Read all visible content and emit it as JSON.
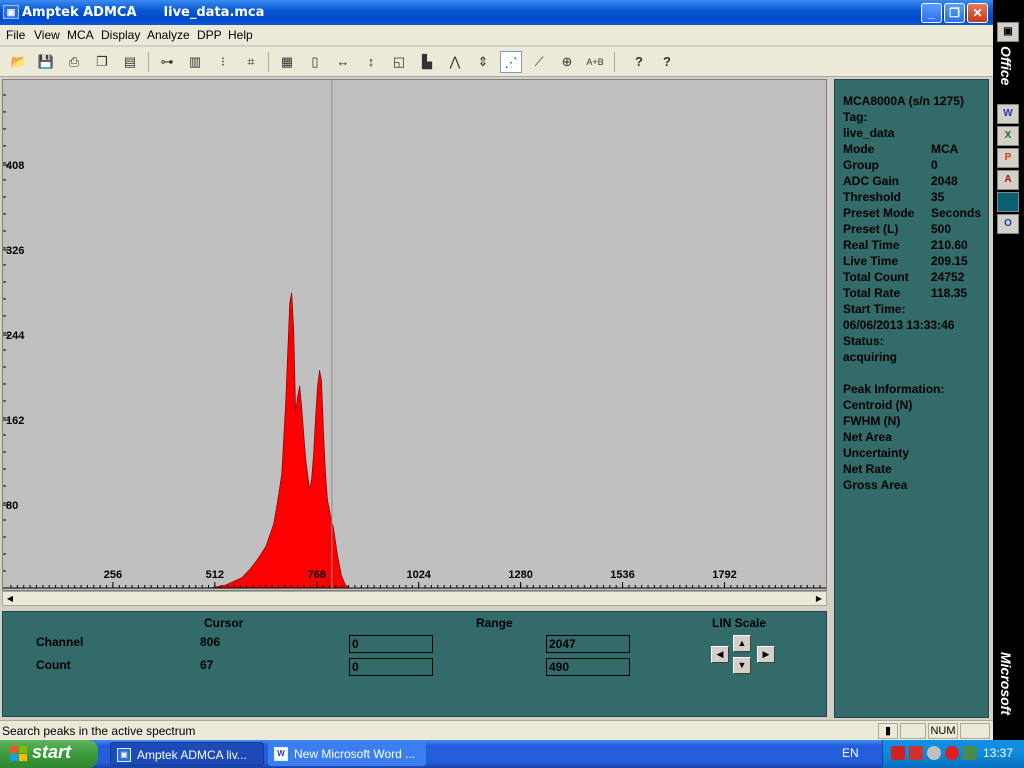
{
  "window": {
    "app_name": "Amptek ADMCA",
    "file_name": "live_data.mca",
    "minimize": "_",
    "maximize": "❐",
    "close": "✕"
  },
  "menu": [
    "File",
    "View",
    "MCA",
    "Display",
    "Analyze",
    "DPP",
    "Help"
  ],
  "toolbar_icons": [
    "open-icon",
    "save-icon",
    "print-icon",
    "copy-icon",
    "properties-icon",
    "connect-icon",
    "acquire-icon",
    "traffic-light-icon",
    "clear-icon",
    "color-icon",
    "list-icon",
    "horizontal-zoom-icon",
    "vertical-zoom-icon",
    "fit-icon",
    "bars-icon",
    "peaks-icon",
    "autoscale-icon",
    "points-icon",
    "line-icon",
    "zoom-icon",
    "a-plus-b-icon",
    "help-icon",
    "context-help-icon"
  ],
  "toolbar_glyphs": {
    "a_plus_b": "A+B",
    "help": "?",
    "context_help": "?"
  },
  "chart_data": {
    "type": "area",
    "title": "",
    "xlabel": "",
    "ylabel": "",
    "xlim": [
      0,
      2047
    ],
    "ylim": [
      0,
      490
    ],
    "x_ticks": [
      256,
      512,
      768,
      1024,
      1280,
      1536,
      1792
    ],
    "y_ticks": [
      80,
      162,
      244,
      326,
      408
    ],
    "grid": false,
    "cursor_channel": 806,
    "fill_color": "#ff0000",
    "background": "#c0c0c0",
    "series": [
      {
        "x": [
          0,
          500,
          540,
          580,
          600,
          620,
          640,
          660,
          670,
          680,
          690,
          700,
          705,
          710,
          715,
          720,
          725,
          730,
          740,
          750,
          755,
          760,
          765,
          770,
          775,
          780,
          785,
          790,
          795,
          800,
          805,
          810,
          820,
          830,
          840,
          850,
          2047
        ],
        "y": [
          0,
          0,
          3,
          10,
          18,
          28,
          40,
          62,
          85,
          110,
          180,
          275,
          285,
          250,
          170,
          185,
          195,
          175,
          125,
          95,
          105,
          130,
          165,
          195,
          210,
          200,
          150,
          110,
          85,
          75,
          65,
          58,
          32,
          12,
          3,
          0,
          0
        ]
      }
    ]
  },
  "cursor_panel": {
    "cursor_header": "Cursor",
    "range_header": "Range",
    "scale_header": "LIN Scale",
    "channel_label": "Channel",
    "channel_value": "806",
    "count_label": "Count",
    "count_value": "67",
    "channel_range_min": "0",
    "channel_range_max": "2047",
    "count_range_min": "0",
    "count_range_max": "490"
  },
  "info": {
    "device": "MCA8000A (s/n     1275)",
    "tag_label": "Tag:",
    "tag_value": "live_data",
    "rows": [
      {
        "label": "Mode",
        "value": "MCA"
      },
      {
        "label": "Group",
        "value": "0"
      },
      {
        "label": "ADC Gain",
        "value": "2048"
      },
      {
        "label": "Threshold",
        "value": "35"
      },
      {
        "label": "Preset Mode",
        "value": "Seconds"
      },
      {
        "label": "Preset (L)",
        "value": "500"
      },
      {
        "label": "Real Time",
        "value": "210.60"
      },
      {
        "label": "Live Time",
        "value": "209.15"
      },
      {
        "label": "Total Count",
        "value": "24752"
      },
      {
        "label": "Total Rate",
        "value": "118.35"
      }
    ],
    "start_label": "Start Time:",
    "start_value": "06/06/2013 13:33:46",
    "status_label": "Status:",
    "status_value": "acquiring",
    "peak_header": "Peak Information:",
    "peak_rows": [
      "Centroid (N)",
      "FWHM (N)",
      "Net Area",
      "Uncertainty",
      "Net Rate",
      "Gross Area"
    ]
  },
  "statusbar": {
    "message": "Search peaks in the active spectrum",
    "num": "NUM"
  },
  "officebar": {
    "top_label": "Office",
    "bottom_label": "Microsoft",
    "icons": [
      "W",
      "X",
      "P",
      "A",
      "",
      "O"
    ]
  },
  "taskbar": {
    "start": "start",
    "tasks": [
      "Amptek ADMCA     liv...",
      "New Microsoft Word ..."
    ],
    "language": "EN",
    "clock": "13:37"
  }
}
